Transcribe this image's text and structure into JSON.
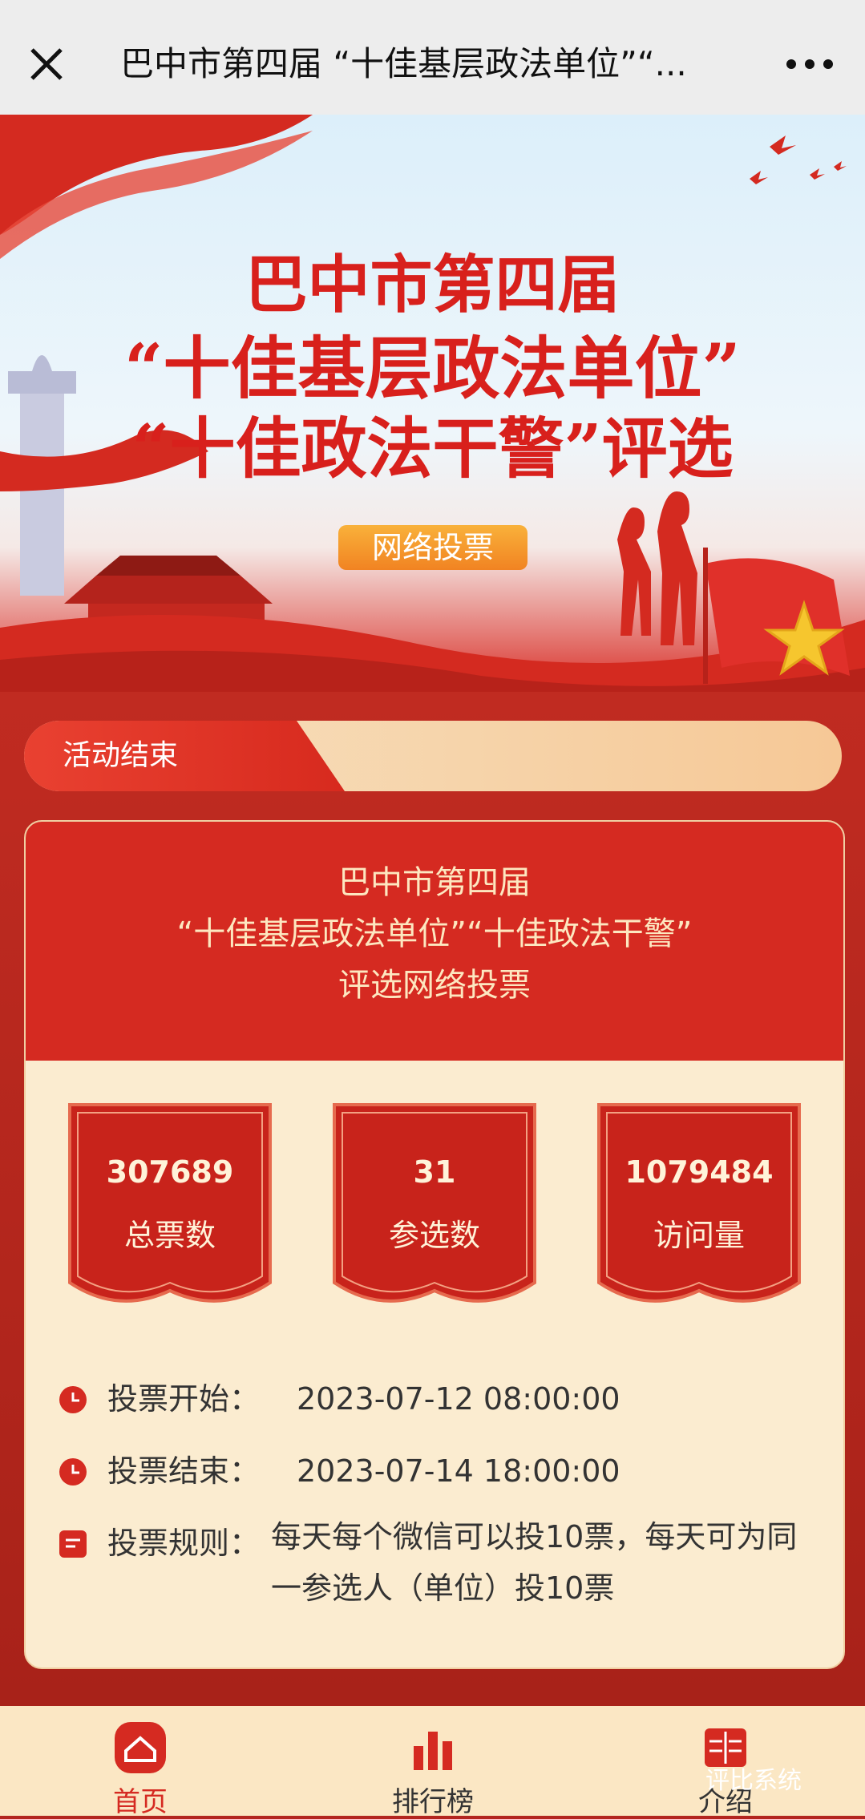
{
  "topbar": {
    "title": "巴中市第四届 “十佳基层政法单位”“...",
    "close_icon": "close-icon",
    "more_icon": "more-icon"
  },
  "banner": {
    "line1": "巴中市第四届",
    "line2": "“十佳基层政法单位”",
    "line3": "“十佳政法干警”评选",
    "vote_button": "网络投票"
  },
  "status": {
    "label": "活动结束"
  },
  "card": {
    "heading": [
      "巴中市第四届",
      "“十佳基层政法单位”“十佳政法干警”",
      "评选网络投票"
    ],
    "stats": [
      {
        "value": "307689",
        "label": "总票数"
      },
      {
        "value": "31",
        "label": "参选数"
      },
      {
        "value": "1079484",
        "label": "访问量"
      }
    ],
    "start": {
      "key": "投票开始：",
      "value": "2023-07-12 08:00:00"
    },
    "end": {
      "key": "投票结束：",
      "value": "2023-07-14 18:00:00"
    },
    "rule": {
      "key": "投票规则：",
      "value": "每天每个微信可以投10票，每天可为同一参选人（单位）投10票"
    }
  },
  "nav": [
    {
      "label": "首页",
      "icon": "home-icon",
      "active": true
    },
    {
      "label": "排行榜",
      "icon": "ranking-icon",
      "active": false
    },
    {
      "label": "介绍",
      "icon": "intro-icon",
      "active": false
    }
  ],
  "watermark": "评比系统",
  "colors": {
    "red": "#d52a21",
    "cream": "#fbecd0",
    "orange": "#f18322"
  }
}
